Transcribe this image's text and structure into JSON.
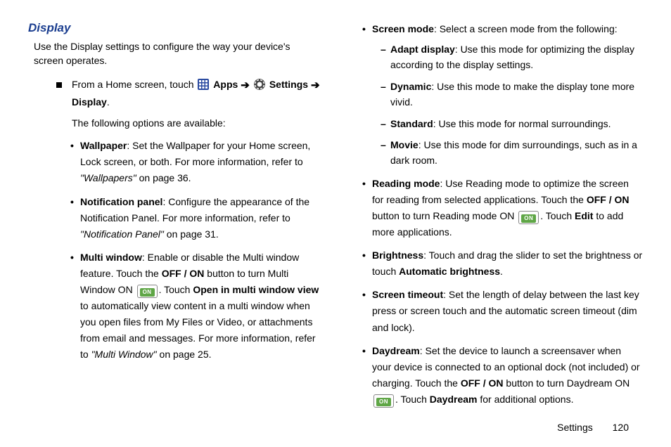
{
  "heading": "Display",
  "intro": "Use the Display settings to configure the way your device's screen operates.",
  "nav": {
    "prefix": "From a Home screen, touch ",
    "apps": "Apps",
    "settings": "Settings",
    "display": "Display"
  },
  "following": "The following options are available:",
  "left_bullets": {
    "wallpaper": {
      "title": "Wallpaper",
      "body1": ": Set the Wallpaper for your Home screen, Lock screen, or both. For more information, refer to ",
      "ref": "\"Wallpapers\"",
      "body2": " on page 36."
    },
    "notif": {
      "title": "Notification panel",
      "body1": ": Configure the appearance of the Notification Panel. For more information, refer to ",
      "ref": "\"Notification Panel\"",
      "body2": " on page 31."
    },
    "multi": {
      "title": "Multi window",
      "body1": ": Enable or disable the Multi window feature. Touch the ",
      "offon": "OFF / ON",
      "body2": " button to turn Multi Window ON ",
      "on_label": "ON",
      "body3": ". Touch ",
      "open": "Open in multi window view",
      "body4": " to automatically view content in a multi window when you open files from My Files or Video, or attachments from email and messages. For more information, refer to ",
      "ref": "\"Multi Window\"",
      "body5": " on page 25."
    }
  },
  "right_bullets": {
    "screen_mode": {
      "title": "Screen mode",
      "body": ": Select a screen mode from the following:",
      "sub": {
        "adapt": {
          "title": "Adapt display",
          "body": ": Use this mode for optimizing the display according to the display settings."
        },
        "dynamic": {
          "title": "Dynamic",
          "body": ": Use this mode to make the display tone more vivid."
        },
        "standard": {
          "title": "Standard",
          "body": ": Use this mode for normal surroundings."
        },
        "movie": {
          "title": "Movie",
          "body": ": Use this mode for dim surroundings, such as in a dark room."
        }
      }
    },
    "reading": {
      "title": "Reading mode",
      "body1": ": Use Reading mode to optimize the screen for reading from selected applications. Touch the ",
      "offon": "OFF / ON",
      "body2": " button to turn Reading mode ON ",
      "on_label": "ON",
      "body3": ". Touch ",
      "edit": "Edit",
      "body4": " to add more applications."
    },
    "brightness": {
      "title": "Brightness",
      "body1": ": Touch and drag the slider to set the brightness or touch ",
      "auto": "Automatic brightness",
      "body2": "."
    },
    "timeout": {
      "title": "Screen timeout",
      "body": ": Set the length of delay between the last key press or screen touch and the automatic screen timeout (dim and lock)."
    },
    "daydream": {
      "title": "Daydream",
      "body1": ": Set the device to launch a screensaver when your device is connected to an optional dock (not included) or charging. Touch the ",
      "offon": "OFF / ON",
      "body2": " button to turn Daydream ON ",
      "on_label": "ON",
      "body3": ". Touch ",
      "dd": "Daydream",
      "body4": " for additional options."
    }
  },
  "footer": {
    "section": "Settings",
    "page": "120"
  }
}
